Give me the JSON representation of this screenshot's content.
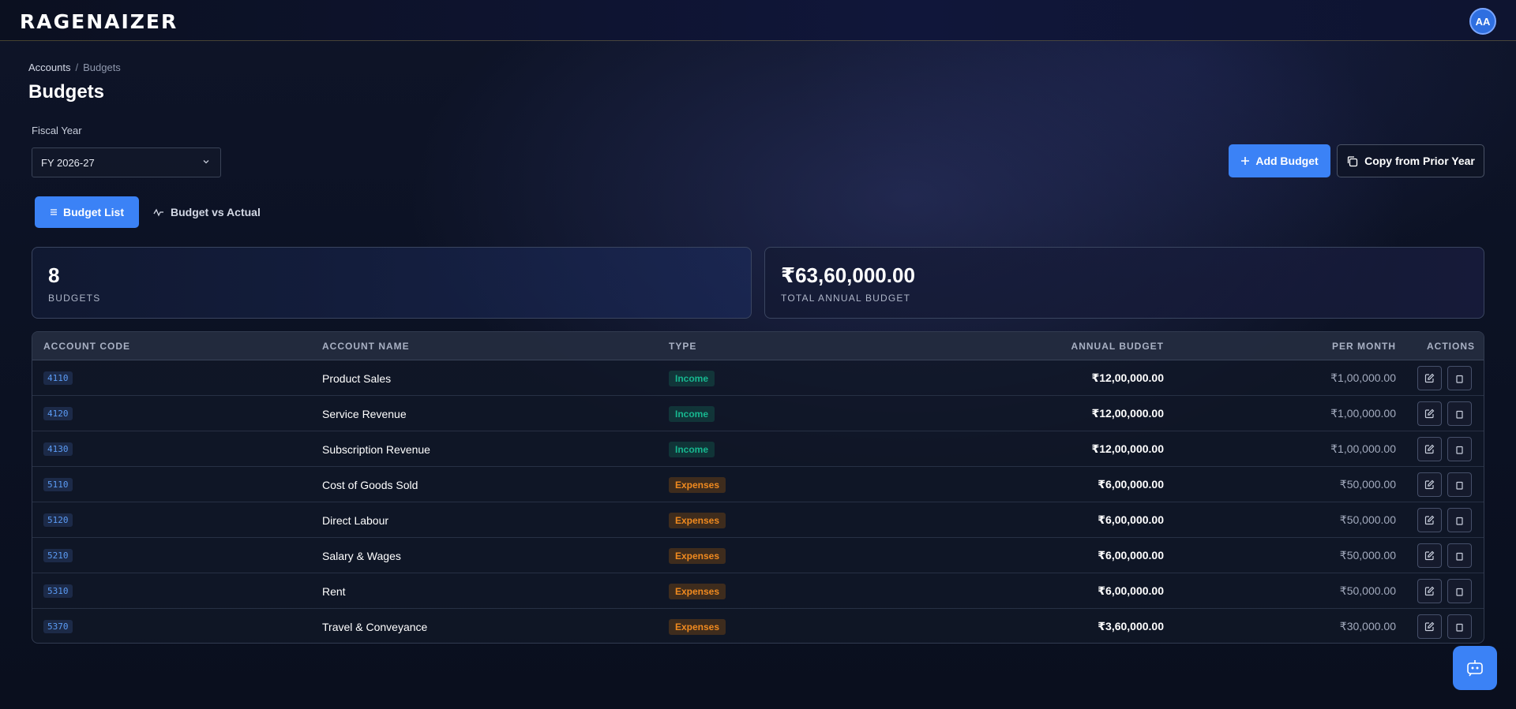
{
  "header": {
    "logo_text": "RAGENAIZER",
    "avatar_initials": "AA"
  },
  "breadcrumb": {
    "parent": "Accounts",
    "separator": "/",
    "current": "Budgets"
  },
  "page": {
    "title": "Budgets"
  },
  "filters": {
    "fiscal_year_label": "Fiscal Year",
    "fiscal_year_value": "FY 2026-27"
  },
  "actions": {
    "add_budget": "Add Budget",
    "copy_prior": "Copy from Prior Year"
  },
  "tabs": [
    {
      "label": "Budget List",
      "active": true,
      "icon": "list-icon"
    },
    {
      "label": "Budget vs Actual",
      "active": false,
      "icon": "activity-icon"
    }
  ],
  "stats": {
    "budgets_count": "8",
    "budgets_label": "BUDGETS",
    "total_value": "₹63,60,000.00",
    "total_label": "TOTAL ANNUAL BUDGET"
  },
  "table": {
    "columns": [
      "ACCOUNT CODE",
      "ACCOUNT NAME",
      "TYPE",
      "ANNUAL BUDGET",
      "PER MONTH",
      "ACTIONS"
    ],
    "rows": [
      {
        "code": "4110",
        "name": "Product Sales",
        "type": "Income",
        "annual": "₹12,00,000.00",
        "monthly": "₹1,00,000.00"
      },
      {
        "code": "4120",
        "name": "Service Revenue",
        "type": "Income",
        "annual": "₹12,00,000.00",
        "monthly": "₹1,00,000.00"
      },
      {
        "code": "4130",
        "name": "Subscription Revenue",
        "type": "Income",
        "annual": "₹12,00,000.00",
        "monthly": "₹1,00,000.00"
      },
      {
        "code": "5110",
        "name": "Cost of Goods Sold",
        "type": "Expenses",
        "annual": "₹6,00,000.00",
        "monthly": "₹50,000.00"
      },
      {
        "code": "5120",
        "name": "Direct Labour",
        "type": "Expenses",
        "annual": "₹6,00,000.00",
        "monthly": "₹50,000.00"
      },
      {
        "code": "5210",
        "name": "Salary & Wages",
        "type": "Expenses",
        "annual": "₹6,00,000.00",
        "monthly": "₹50,000.00"
      },
      {
        "code": "5310",
        "name": "Rent",
        "type": "Expenses",
        "annual": "₹6,00,000.00",
        "monthly": "₹50,000.00"
      },
      {
        "code": "5370",
        "name": "Travel & Conveyance",
        "type": "Expenses",
        "annual": "₹3,60,000.00",
        "monthly": "₹30,000.00"
      }
    ]
  },
  "colors": {
    "accent": "#3b82f6",
    "income": "#17b890",
    "expenses": "#f08a1f"
  }
}
